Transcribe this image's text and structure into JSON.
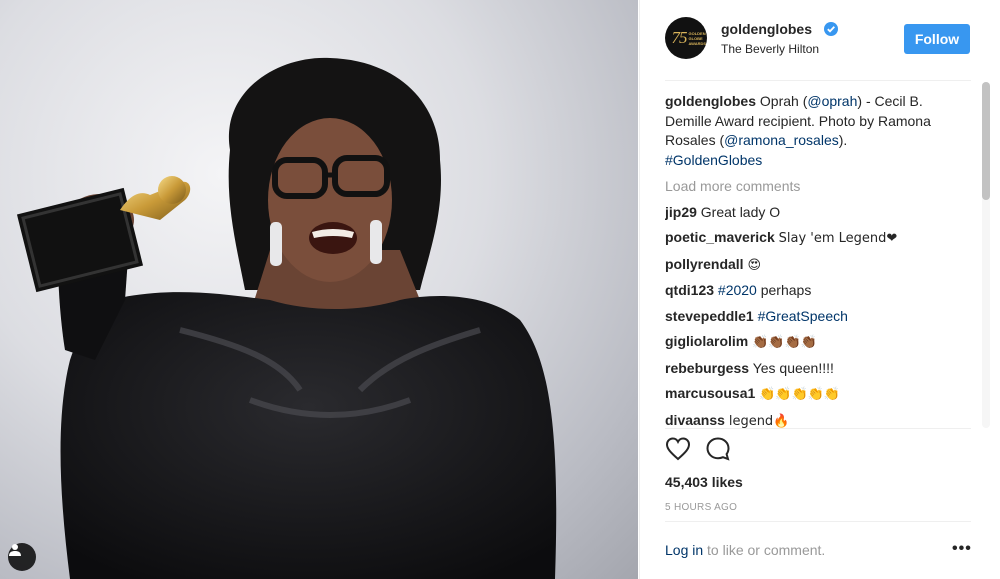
{
  "post": {
    "username": "goldenglobes",
    "location": "The Beverly Hilton",
    "follow_label": "Follow",
    "avatar_text": "75",
    "avatar_subtext": "GOLDEN GLOBE AWARDS",
    "caption_rest": " Oprah (",
    "caption_mention1": "@oprah",
    "caption_mid": ") - Cecil B. Demille Award recipient. Photo by Ramona Rosales (",
    "caption_mention2": "@ramona_rosales",
    "caption_end": ").",
    "caption_hashtag": "#GoldenGlobes",
    "load_more": "Load more comments",
    "likes": "45,403 likes",
    "time": "5 HOURS AGO",
    "login_link": "Log in",
    "login_rest": " to like or comment.",
    "more_icon": "•••"
  },
  "comments": [
    {
      "user": "jip29",
      "text": "Great lady O",
      "link": ""
    },
    {
      "user": "poetic_maverick",
      "text": "Slay 'em Legend❤",
      "link": ""
    },
    {
      "user": "pollyrendall",
      "text": "😍",
      "link": ""
    },
    {
      "user": "qtdi123",
      "text": " perhaps",
      "link": "#2020"
    },
    {
      "user": "stevepeddle1",
      "text": "",
      "link": "#GreatSpeech"
    },
    {
      "user": "gigliolarolim",
      "text": "👏🏾👏🏾👏🏾👏🏾",
      "link": ""
    },
    {
      "user": "rebeburgess",
      "text": "Yes queen!!!!",
      "link": ""
    },
    {
      "user": "marcusousa1",
      "text": "👏👏👏👏👏",
      "link": ""
    },
    {
      "user": "divaanss",
      "text": "legend🔥",
      "link": ""
    }
  ],
  "icons": {
    "verified": "verified-badge-icon",
    "like": "heart-icon",
    "comment": "comment-bubble-icon",
    "tag": "user-tag-icon"
  },
  "colors": {
    "follow": "#3897f0",
    "link": "#003569",
    "muted": "#999999"
  }
}
